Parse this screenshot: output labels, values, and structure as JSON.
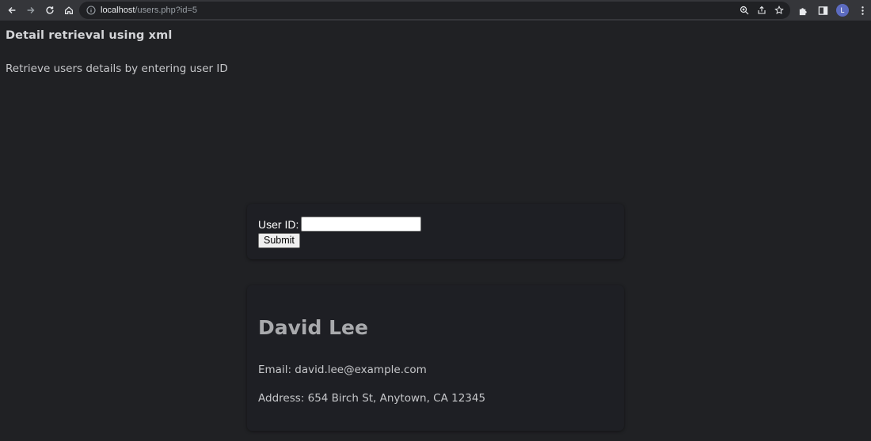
{
  "browser": {
    "url_host": "localhost",
    "url_path": "/users.php?id=5",
    "profile_initial": "L",
    "icons": [
      "back-icon",
      "forward-icon",
      "reload-icon",
      "home-icon",
      "site-info-icon",
      "zoom-icon",
      "share-icon",
      "star-icon",
      "extensions-icon",
      "side-panel-icon",
      "avatar",
      "menu-icon"
    ]
  },
  "page": {
    "title": "Detail retrieval using xml",
    "subtitle": "Retrieve users details by entering user ID"
  },
  "form": {
    "label": "User ID:",
    "input_value": "",
    "submit_label": "Submit"
  },
  "user": {
    "name": "David Lee",
    "email": "Email: david.lee@example.com",
    "address": "Address: 654 Birch St, Anytown, CA 12345"
  },
  "colors": {
    "background": "#202124",
    "card": "#1e1f24",
    "chrome": "#35363a"
  }
}
